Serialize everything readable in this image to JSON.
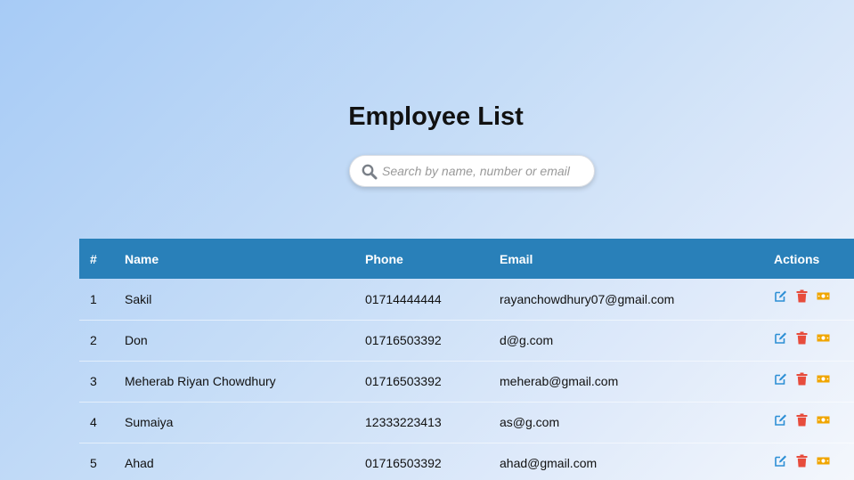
{
  "page": {
    "title": "Employee List"
  },
  "search": {
    "placeholder": "Search by name, number or email",
    "value": ""
  },
  "table": {
    "headers": {
      "num": "#",
      "name": "Name",
      "phone": "Phone",
      "email": "Email",
      "actions": "Actions"
    },
    "rows": [
      {
        "num": "1",
        "name": "Sakil",
        "phone": "01714444444",
        "email": "rayanchowdhury07@gmail.com"
      },
      {
        "num": "2",
        "name": "Don",
        "phone": "01716503392",
        "email": "d@g.com"
      },
      {
        "num": "3",
        "name": "Meherab Riyan Chowdhury",
        "phone": "01716503392",
        "email": "meherab@gmail.com"
      },
      {
        "num": "4",
        "name": "Sumaiya",
        "phone": "12333223413",
        "email": "as@g.com"
      },
      {
        "num": "5",
        "name": "Ahad",
        "phone": "01716503392",
        "email": "ahad@gmail.com"
      }
    ],
    "row_actions": [
      "edit-icon",
      "delete-icon",
      "salary-icon"
    ]
  },
  "colors": {
    "header_bg": "#2980b9",
    "edit": "#2d8fd5",
    "delete": "#e74c3c",
    "salary": "#f0a500"
  }
}
